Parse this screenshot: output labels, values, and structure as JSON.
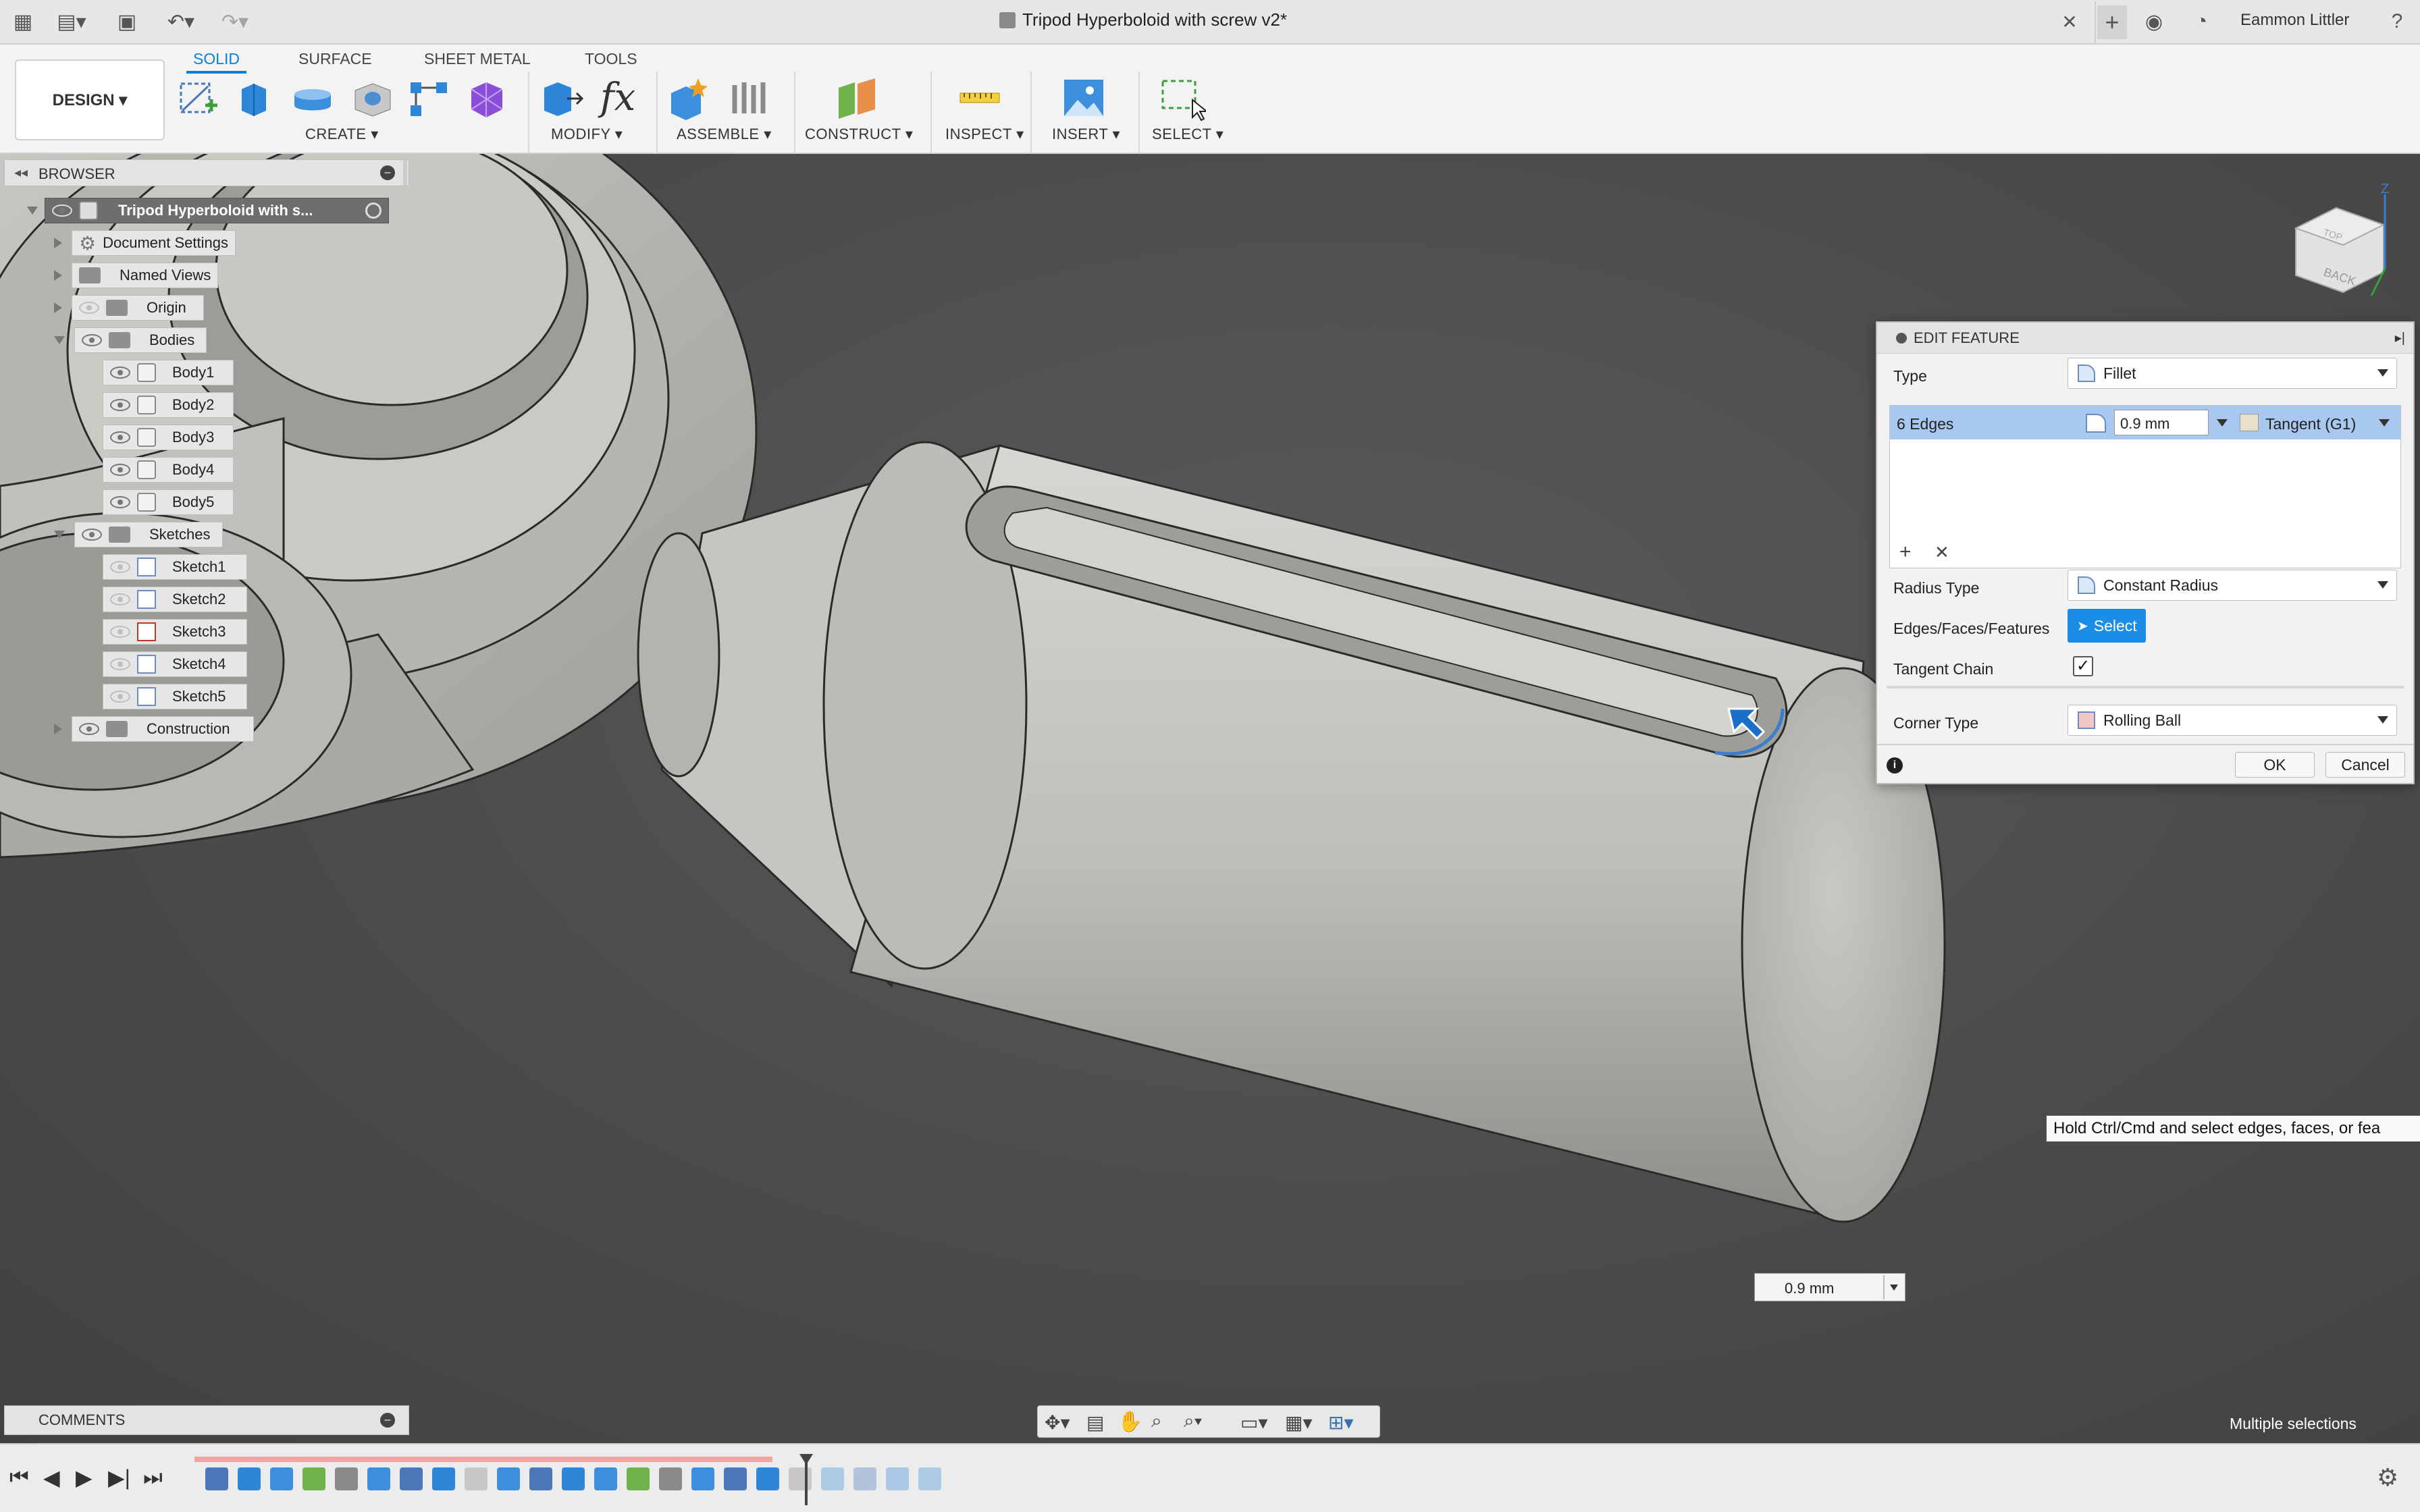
{
  "window": {
    "title": "Tripod Hyperboloid with screw v2*",
    "user": "Eammon Littler"
  },
  "toolbar": {
    "workspace": "DESIGN ▾",
    "tabs": [
      "SOLID",
      "SURFACE",
      "SHEET METAL",
      "TOOLS"
    ],
    "groups": [
      "CREATE ▾",
      "MODIFY ▾",
      "ASSEMBLE ▾",
      "CONSTRUCT ▾",
      "INSPECT ▾",
      "INSERT ▾",
      "SELECT ▾"
    ]
  },
  "browser": {
    "title": "BROWSER",
    "root": "Tripod Hyperboloid with s...",
    "items": [
      {
        "label": "Document Settings",
        "kind": "gear"
      },
      {
        "label": "Named Views",
        "kind": "folder"
      },
      {
        "label": "Origin",
        "kind": "folder"
      },
      {
        "label": "Bodies",
        "kind": "folder"
      },
      {
        "label": "Body1",
        "kind": "body"
      },
      {
        "label": "Body2",
        "kind": "body"
      },
      {
        "label": "Body3",
        "kind": "body"
      },
      {
        "label": "Body4",
        "kind": "body"
      },
      {
        "label": "Body5",
        "kind": "body"
      },
      {
        "label": "Sketches",
        "kind": "folder"
      },
      {
        "label": "Sketch1",
        "kind": "sketch"
      },
      {
        "label": "Sketch2",
        "kind": "sketch"
      },
      {
        "label": "Sketch3",
        "kind": "sketch"
      },
      {
        "label": "Sketch4",
        "kind": "sketch"
      },
      {
        "label": "Sketch5",
        "kind": "sketch"
      },
      {
        "label": "Construction",
        "kind": "folder"
      }
    ]
  },
  "dialog": {
    "title": "EDIT FEATURE",
    "type_label": "Type",
    "type_value": "Fillet",
    "edges_label": "6 Edges",
    "edges_value": "0.9 mm",
    "continuity": "Tangent (G1)",
    "radius_type_label": "Radius Type",
    "radius_type_value": "Constant Radius",
    "efs_label": "Edges/Faces/Features",
    "select_label": "Select",
    "tangent_chain_label": "Tangent Chain",
    "tangent_chain_checked": true,
    "corner_type_label": "Corner Type",
    "corner_type_value": "Rolling Ball",
    "ok": "OK",
    "cancel": "Cancel"
  },
  "tooltip": "Hold Ctrl/Cmd and select edges, faces, or fea",
  "dimension_input": "0.9 mm",
  "viewcube": {
    "face": "BACK",
    "top_face": "TOP",
    "axis": "Z"
  },
  "comments": {
    "title": "COMMENTS"
  },
  "status": "Multiple selections",
  "colors": {
    "accent": "#0d7fd6",
    "select_button": "#1a8ee6",
    "selection_row": "#a8c8ef",
    "timeline_marker": "#f2a2a2"
  }
}
